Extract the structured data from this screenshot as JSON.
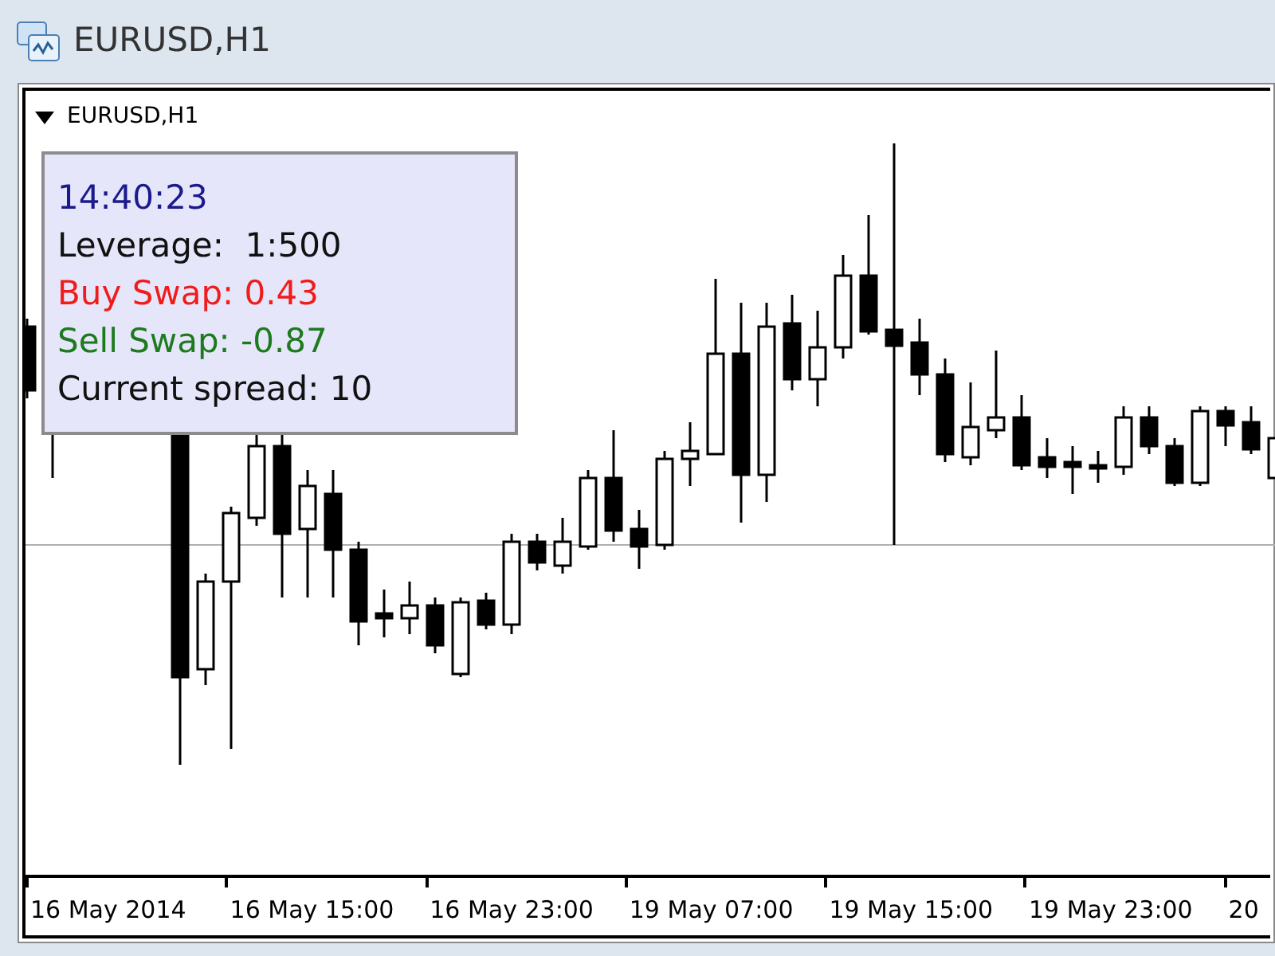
{
  "window": {
    "title": "EURUSD,H1"
  },
  "chart": {
    "symbol_label": "EURUSD,H1",
    "info_panel": [
      {
        "text": "14:40:23",
        "color": "#1a1a8c"
      },
      {
        "text": "Leverage:  1:500",
        "color": "#111111"
      },
      {
        "text": "Buy Swap: 0.43",
        "color": "#f01c1c"
      },
      {
        "text": "Sell Swap: -0.87",
        "color": "#1e7a1e"
      },
      {
        "text": "Current spread: 10",
        "color": "#111111"
      }
    ],
    "time_axis": [
      "16 May 2014",
      "16 May 15:00",
      "16 May 23:00",
      "19 May 07:00",
      "19 May 15:00",
      "19 May 23:00",
      "20"
    ]
  }
}
